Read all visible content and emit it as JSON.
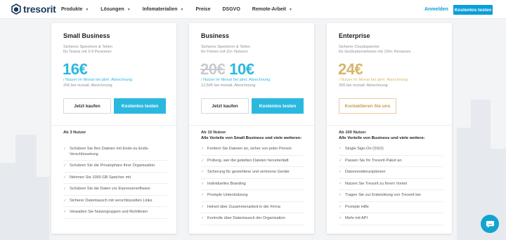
{
  "brand": {
    "name": "tresorit"
  },
  "nav": {
    "items": [
      {
        "label": "Produkte",
        "has_dropdown": true
      },
      {
        "label": "Lösungen",
        "has_dropdown": true
      },
      {
        "label": "Infomaterialien",
        "has_dropdown": true
      },
      {
        "label": "Preise",
        "has_dropdown": false
      },
      {
        "label": "DSGVO",
        "has_dropdown": false
      },
      {
        "label": "Remote-Arbeit",
        "has_dropdown": true
      }
    ],
    "login_label": "Anmelden",
    "cta_label": "Kostenlos testen"
  },
  "plans": [
    {
      "name": "Small Business",
      "desc1": "Sicheres Speichern & Teilen",
      "desc2": "für Teams mit 3-9 Personen",
      "old_price": "",
      "price": "16€",
      "price_color": "#2bb8de",
      "unit": "/ Nutzer im Monat bei jährl. Abrechnung",
      "monthly": "20€ bei monatl. Abrechnung",
      "buttons": [
        {
          "label": "Jetzt kaufen",
          "style": "outline"
        },
        {
          "label": "Kostenlos testen",
          "style": "blue"
        }
      ],
      "feat_head_line1": "Ab 3 Nutzer",
      "feat_head_line2": "",
      "features": [
        "Schützen Sie Ihre Dateien mit Ende-zu-Ende-Verschlüsselung",
        "Schützen Sie die Privatsphäre Ihrer Organisation",
        "Nehmen Sie 1000 GB Speicher mit",
        "Schützen Sie die Daten vor Erpressersoftware",
        "Sicherer Datentausch mit verschlüsselten Links",
        "Verwalten Sie Nutzergruppen und Richtlinien"
      ]
    },
    {
      "name": "Business",
      "desc1": "Sicheres Speichern & Teilen",
      "desc2": "für Firmen mit 10+ Nutzern",
      "old_price": "20€",
      "price": "10€",
      "price_color": "#2bb8de",
      "unit": "/ Nutzer im Monat bei jährl. Abrechnung",
      "monthly": "12,50€ bei monatl. Abrechnung",
      "buttons": [
        {
          "label": "Jetzt kaufen",
          "style": "outline"
        },
        {
          "label": "Kostenlos testen",
          "style": "blue"
        }
      ],
      "feat_head_line1": "Ab 10 Nutzer",
      "feat_head_line2": "Alle Vorteile von Small Business und viele weiteren:",
      "features": [
        "Fordern Sie Dateien an, sicher von jeder Person",
        "Prüfung, wer die geteilten Dateien herunterlädt",
        "Sicherung für gestohlene und verlorene Geräte",
        "Individuelles Branding",
        "Prompte Unterstützung",
        "Hoheit über Zusammenarbeit in der Firma",
        "Kontrolle über Datentausch der Organisation"
      ]
    },
    {
      "name": "Enterprise",
      "desc1": "Sicherer Cloudspeicher",
      "desc2": "für Großunternehmen mit 100+ Personen",
      "old_price": "",
      "price": "24€",
      "price_color": "#d9b46a",
      "unit": "/ Nutzer im Monat bei jährl. Abrechnung",
      "monthly": "30€ bei monatl. Abrechnung",
      "buttons": [
        {
          "label": "Kontaktieren Sie uns",
          "style": "gold"
        }
      ],
      "feat_head_line1": "Ab 100 Nutzer",
      "feat_head_line2": "Alle Vorteile von Business und viele weitere:",
      "features": [
        "Single Sign-On (SSO)",
        "Passen Sie Ihr Tresorit-Paket an",
        "Datenresidenzoptionen",
        "Nutzen Sie Tresorit zu Ihrem Vorteil",
        "Tragen Sie zur Entwicklung von Tresorit bei",
        "Prompte Hilfe",
        "Mehr mit API"
      ]
    }
  ],
  "colors": {
    "accent": "#0a9fd8",
    "plan_blue": "#2bb8de",
    "gold": "#d9b46a"
  },
  "chat": {
    "icon": "chat-bubble-icon"
  }
}
